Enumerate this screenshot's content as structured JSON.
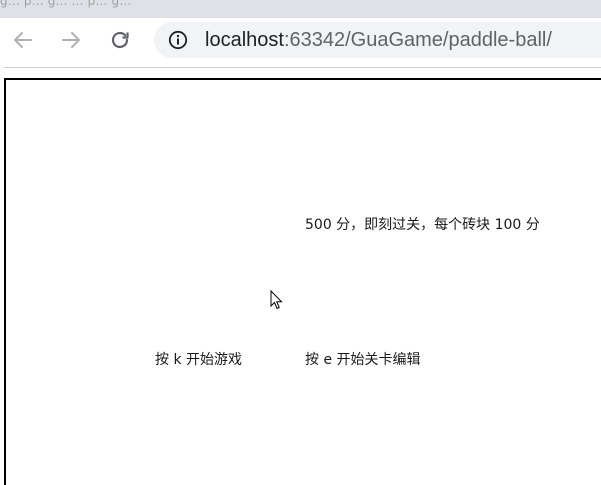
{
  "browser": {
    "tab_strip_text": "g... p... g... ... p... g...",
    "url": {
      "host": "localhost",
      "rest": ":63342/GuaGame/paddle-ball/"
    },
    "icons": {
      "back": "arrow-left-icon",
      "forward": "arrow-right-icon",
      "reload": "reload-icon",
      "info": "info-icon"
    }
  },
  "game": {
    "rule_text": "500 分，即刻过关，每个砖块 100 分",
    "start_hint": "按 k 开始游戏",
    "edit_hint": "按 e 开始关卡编辑"
  },
  "colors": {
    "omnibox_bg": "#f1f3f4",
    "tab_strip_bg": "#dee1e6",
    "frame_border": "#000000"
  }
}
